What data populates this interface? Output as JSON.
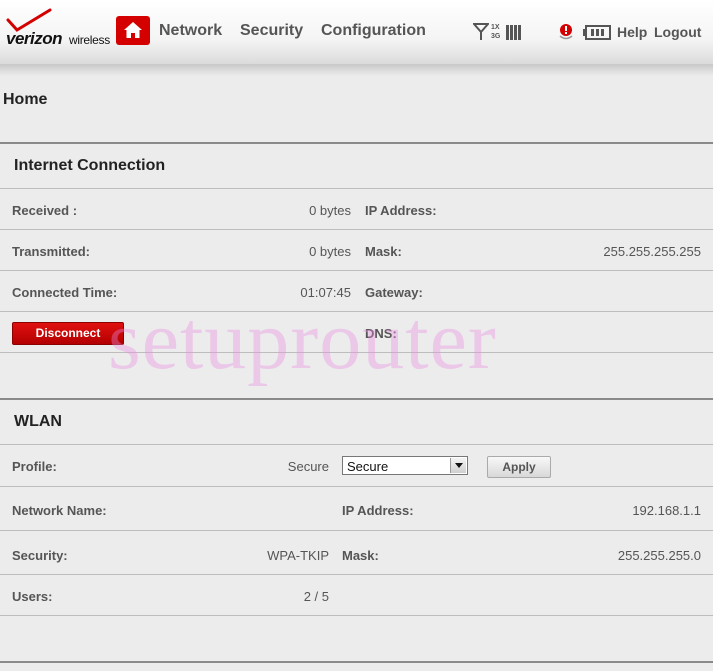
{
  "brand": {
    "name": "verizon",
    "suffix": "wireless"
  },
  "nav": {
    "network": "Network",
    "security": "Security",
    "configuration": "Configuration"
  },
  "status": {
    "tech_1x": "1X",
    "tech_3g": "3G"
  },
  "links": {
    "help": "Help",
    "logout": "Logout"
  },
  "page_title": "Home",
  "internet": {
    "title": "Internet Connection",
    "received_label": "Received :",
    "received_value": "0 bytes",
    "transmitted_label": "Transmitted:",
    "transmitted_value": "0 bytes",
    "connected_time_label": "Connected Time:",
    "connected_time_value": "01:07:45",
    "disconnect_label": "Disconnect",
    "ip_label": "IP Address:",
    "ip_value": "",
    "mask_label": "Mask:",
    "mask_value": "255.255.255.255",
    "gateway_label": "Gateway:",
    "gateway_value": "",
    "dns_label": "DNS:",
    "dns_value": ""
  },
  "wlan": {
    "title": "WLAN",
    "profile_label": "Profile:",
    "profile_value": "Secure",
    "profile_select": "Secure",
    "apply_label": "Apply",
    "network_name_label": "Network Name:",
    "network_name_value": "",
    "ip_label": "IP Address:",
    "ip_value": "192.168.1.1",
    "security_label": "Security:",
    "security_value": "WPA-TKIP",
    "mask_label": "Mask:",
    "mask_value": "255.255.255.0",
    "users_label": "Users:",
    "users_value": "2 / 5"
  },
  "watermark": "setuprouter",
  "colors": {
    "accent": "#d40000",
    "background": "#ececec",
    "watermark": "#eb8ce1"
  },
  "icons": [
    "home-icon",
    "signal-icon",
    "signal-bars-icon",
    "alert-icon",
    "battery-icon"
  ]
}
